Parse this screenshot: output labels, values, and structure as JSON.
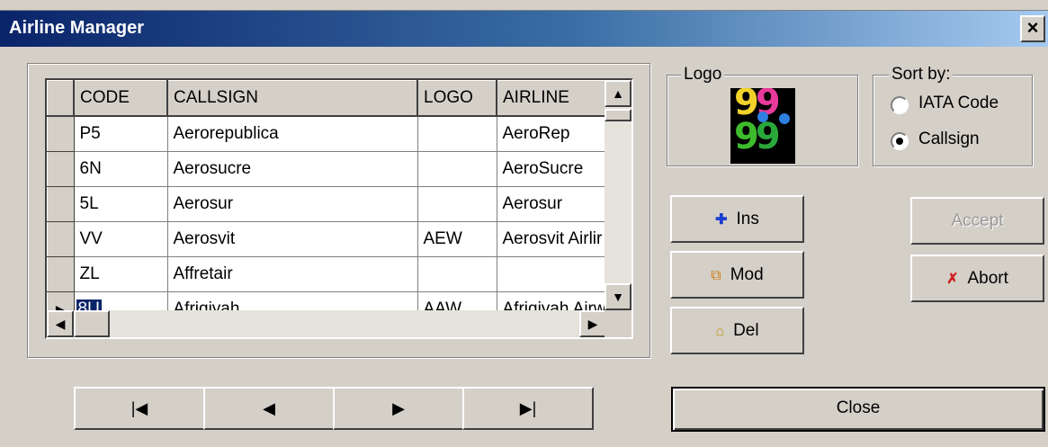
{
  "window": {
    "title": "Airline Manager",
    "close_glyph": "×"
  },
  "grid": {
    "columns": [
      "",
      "CODE",
      "CALLSIGN",
      "LOGO",
      "AIRLINE"
    ],
    "rows": [
      {
        "code": "P5",
        "callsign": "Aerorepublica",
        "logo": "",
        "airline": "AeroRep"
      },
      {
        "code": "6N",
        "callsign": "Aerosucre",
        "logo": "",
        "airline": "AeroSucre"
      },
      {
        "code": "5L",
        "callsign": "Aerosur",
        "logo": "",
        "airline": "Aerosur"
      },
      {
        "code": "VV",
        "callsign": "Aerosvit",
        "logo": "AEW",
        "airline": "Aerosvit Airlir"
      },
      {
        "code": "ZL",
        "callsign": "Affretair",
        "logo": "",
        "airline": ""
      },
      {
        "code": "8U",
        "callsign": "Afriqiyah",
        "logo": "AAW",
        "airline": "Afriqiyah Airw"
      }
    ],
    "current_row_indicator": "▶"
  },
  "logo_group": {
    "label": "Logo",
    "image_text": "9999",
    "image_icon": "airline-logo-icon"
  },
  "sort_group": {
    "label": "Sort by:",
    "options": [
      {
        "label": "IATA Code",
        "selected": false
      },
      {
        "label": "Callsign",
        "selected": true
      }
    ]
  },
  "buttons": {
    "ins": "Ins",
    "mod": "Mod",
    "del": "Del",
    "accept": "Accept",
    "abort": "Abort",
    "close": "Close",
    "nav_first": "|◀",
    "nav_prev": "◀",
    "nav_next": "▶",
    "nav_last": "▶|"
  },
  "colors": {
    "titlebar_start": "#0a246a",
    "titlebar_end": "#a6caf0",
    "selection": "#0a246a",
    "face": "#d4d0c8"
  }
}
